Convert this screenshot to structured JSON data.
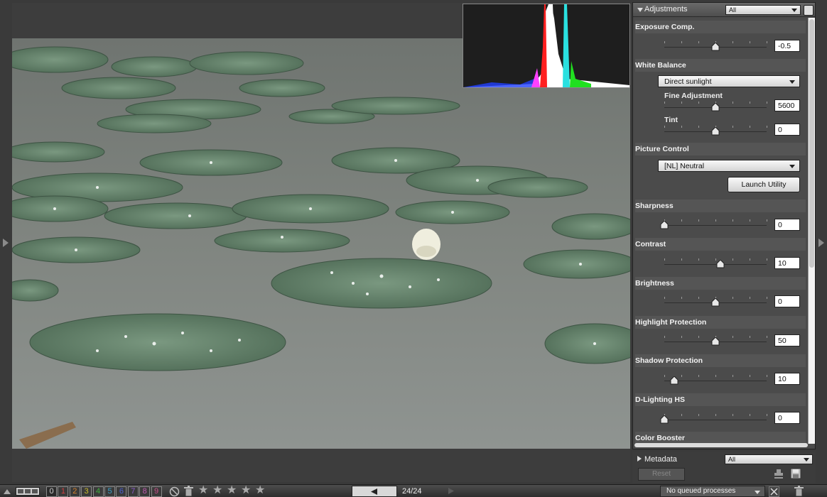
{
  "panel": {
    "title": "Adjustments",
    "filter": "All"
  },
  "adjustments": {
    "exposure": {
      "label": "Exposure Comp.",
      "value": "-0.5",
      "level": 0.5
    },
    "white_balance": {
      "label": "White Balance",
      "preset": "Direct sunlight",
      "fine_label": "Fine Adjustment",
      "fine_value": "5600",
      "fine_level": 0.5,
      "tint_label": "Tint",
      "tint_value": "0",
      "tint_level": 0.5
    },
    "picture_control": {
      "label": "Picture Control",
      "preset": "[NL] Neutral",
      "launch_button": "Launch Utility"
    },
    "sharpness": {
      "label": "Sharpness",
      "value": "0",
      "level": 0.0
    },
    "contrast": {
      "label": "Contrast",
      "value": "10",
      "level": 0.55
    },
    "brightness": {
      "label": "Brightness",
      "value": "0",
      "level": 0.5
    },
    "highlight_protection": {
      "label": "Highlight Protection",
      "value": "50",
      "level": 0.5
    },
    "shadow_protection": {
      "label": "Shadow Protection",
      "value": "10",
      "level": 0.1
    },
    "d_lighting": {
      "label": "D-Lighting HS",
      "value": "0",
      "level": 0.0
    },
    "color_booster": {
      "label": "Color Booster"
    }
  },
  "metadata": {
    "title": "Metadata",
    "filter": "All",
    "reset_button": "Reset"
  },
  "toolbar": {
    "labels": [
      "0",
      "1",
      "2",
      "3",
      "4",
      "5",
      "6",
      "7",
      "8",
      "9"
    ],
    "label_colors": [
      "#cfcfcf",
      "#d14040",
      "#d4802a",
      "#c9b92a",
      "#3fae3f",
      "#3aa0c8",
      "#4a5ed0",
      "#8a5ac8",
      "#c05ab0",
      "#c8508a"
    ],
    "rating_stars": 5,
    "counter": "24/24",
    "queue_status": "No queued processes"
  },
  "icons": {
    "left_collapse": "triangle-left-icon",
    "right_collapse": "triangle-right-icon",
    "reject": "reject-circle-icon",
    "trash": "trash-icon",
    "stamp": "stamp-icon",
    "save": "save-icon"
  }
}
